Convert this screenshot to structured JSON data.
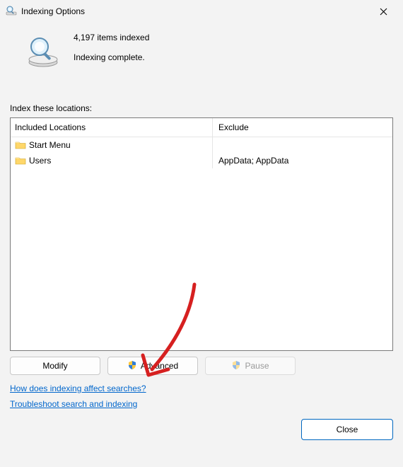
{
  "window": {
    "title": "Indexing Options"
  },
  "status": {
    "count_text": "4,197 items indexed",
    "state_text": "Indexing complete."
  },
  "section": {
    "locations_label": "Index these locations:"
  },
  "table": {
    "headers": {
      "included": "Included Locations",
      "exclude": "Exclude"
    },
    "rows": [
      {
        "included": "Start Menu",
        "exclude": ""
      },
      {
        "included": "Users",
        "exclude": "AppData; AppData"
      }
    ]
  },
  "buttons": {
    "modify": "Modify",
    "advanced": "Advanced",
    "pause": "Pause",
    "close": "Close"
  },
  "links": {
    "how": "How does indexing affect searches?",
    "troubleshoot": "Troubleshoot search and indexing"
  },
  "annotation": {
    "color": "#d62020"
  }
}
